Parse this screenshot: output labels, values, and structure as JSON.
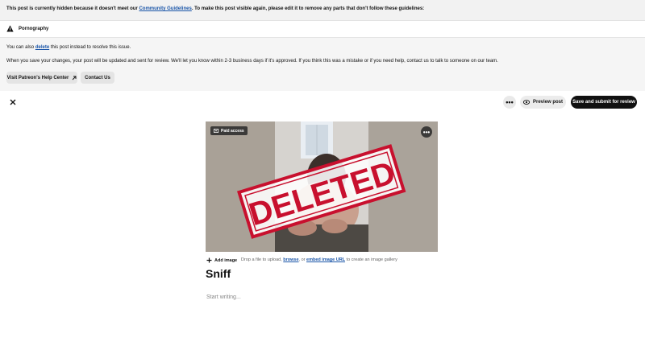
{
  "banner": {
    "pre": "This post is currently hidden because it doesn't meet our ",
    "link": "Community Guidelines",
    "post": ". To make this post visible again, please edit it to remove any parts that don't follow these guidelines:"
  },
  "violation": {
    "icon": "warning-icon",
    "label": "Pornography"
  },
  "info": {
    "line1_pre": "You can also ",
    "line1_link": "delete",
    "line1_post": " this post instead to resolve this issue.",
    "line2": "When you save your changes, your post will be updated and sent for review. We'll let you know within 2-3 business days if it's approved. If you think this was a mistake or if you need help, contact us to talk to someone on our team.",
    "help_button": "Visit Patreon's Help Center",
    "contact_button": "Contact Us"
  },
  "toolbar": {
    "more_label": "•••",
    "preview_label": "Preview post",
    "save_label": "Save and submit for review"
  },
  "image": {
    "badge": "Paid access",
    "more_label": "•••",
    "stamp": "DELETED"
  },
  "image_toolbar": {
    "add_label": "Add image",
    "hint_pre": "Drop a file to upload, ",
    "browse": "browse",
    "hint_mid": ", or ",
    "embed": "embed image URL",
    "hint_post": " to create an image gallery"
  },
  "post": {
    "title": "Sniff",
    "placeholder": "Start writing..."
  },
  "colors": {
    "accent_link": "#1a55a8",
    "stamp_red": "#c8102e",
    "primary": "#111111"
  }
}
